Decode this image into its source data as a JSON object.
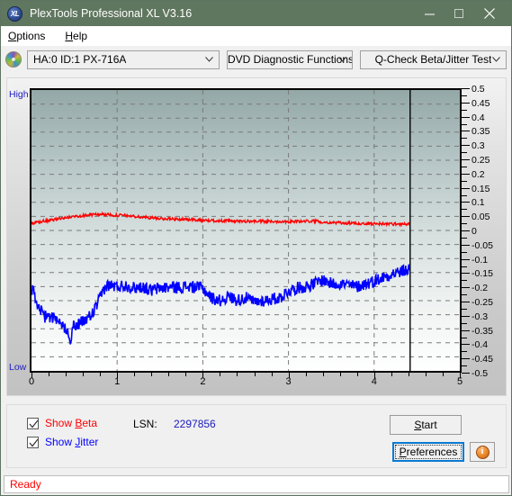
{
  "window": {
    "title": "PlexTools Professional XL V3.16",
    "icon": "XL",
    "minimize": "minimize-icon",
    "maximize": "maximize-icon",
    "close": "close-icon",
    "titlebar_color": "#60775f"
  },
  "menu": {
    "items": [
      {
        "label": "Options",
        "accel": "O"
      },
      {
        "label": "Help",
        "accel": "H"
      }
    ]
  },
  "toolbar": {
    "drive": "HA:0 ID:1  PX-716A",
    "function": "DVD Diagnostic Functions",
    "test": "Q-Check Beta/Jitter Test"
  },
  "chart_data": {
    "type": "line",
    "title": "Q-Check Beta/Jitter Test",
    "xlabel": "",
    "ylabel": "",
    "xlim": [
      0,
      5
    ],
    "ylim": [
      -0.5,
      0.5
    ],
    "grid": true,
    "legend": "none",
    "left_axis_high": "High",
    "left_axis_low": "Low",
    "xticks": [
      0,
      1,
      2,
      3,
      4,
      5
    ],
    "xtick_labels": [
      "0",
      "1",
      "2",
      "3",
      "4",
      "5"
    ],
    "yticks": [
      0.5,
      0.45,
      0.4,
      0.35,
      0.3,
      0.25,
      0.2,
      0.15,
      0.1,
      0.05,
      0,
      -0.05,
      -0.1,
      -0.15,
      -0.2,
      -0.25,
      -0.3,
      -0.35,
      -0.4,
      -0.45,
      -0.5
    ],
    "ytick_labels": [
      "0.5",
      "0.45",
      "0.4",
      "0.35",
      "0.3",
      "0.25",
      "0.2",
      "0.15",
      "0.1",
      "0.05",
      "0",
      "-0.05",
      "-0.1",
      "-0.15",
      "-0.2",
      "-0.25",
      "-0.3",
      "-0.35",
      "-0.4",
      "-0.45",
      "-0.5"
    ],
    "data_end_x": 4.42,
    "series": [
      {
        "name": "Beta",
        "color": "#ff0000",
        "x": [
          0.0,
          0.05,
          0.1,
          0.15,
          0.2,
          0.25,
          0.3,
          0.35,
          0.4,
          0.45,
          0.5,
          0.55,
          0.6,
          0.65,
          0.7,
          0.75,
          0.8,
          0.85,
          0.9,
          0.95,
          1.0,
          1.05,
          1.1,
          1.15,
          1.2,
          1.25,
          1.3,
          1.35,
          1.4,
          1.45,
          1.5,
          1.55,
          1.6,
          1.65,
          1.7,
          1.75,
          1.8,
          1.85,
          1.9,
          1.95,
          2.0,
          2.1,
          2.2,
          2.3,
          2.4,
          2.5,
          2.6,
          2.7,
          2.8,
          2.9,
          3.0,
          3.1,
          3.2,
          3.3,
          3.4,
          3.5,
          3.6,
          3.7,
          3.8,
          3.9,
          4.0,
          4.1,
          4.2,
          4.3,
          4.42
        ],
        "y": [
          0.022,
          0.027,
          0.03,
          0.034,
          0.033,
          0.038,
          0.041,
          0.043,
          0.045,
          0.047,
          0.05,
          0.052,
          0.053,
          0.055,
          0.056,
          0.057,
          0.058,
          0.057,
          0.056,
          0.055,
          0.054,
          0.054,
          0.053,
          0.052,
          0.05,
          0.048,
          0.047,
          0.046,
          0.045,
          0.044,
          0.043,
          0.042,
          0.042,
          0.041,
          0.04,
          0.04,
          0.039,
          0.038,
          0.038,
          0.037,
          0.036,
          0.035,
          0.034,
          0.034,
          0.033,
          0.033,
          0.033,
          0.032,
          0.032,
          0.032,
          0.032,
          0.032,
          0.033,
          0.034,
          0.03,
          0.028,
          0.027,
          0.026,
          0.025,
          0.024,
          0.024,
          0.024,
          0.023,
          0.023,
          0.023
        ]
      },
      {
        "name": "Jitter",
        "color": "#0000ff",
        "x": [
          0.0,
          0.03,
          0.06,
          0.09,
          0.12,
          0.15,
          0.18,
          0.21,
          0.24,
          0.27,
          0.3,
          0.33,
          0.36,
          0.39,
          0.42,
          0.45,
          0.48,
          0.51,
          0.54,
          0.57,
          0.6,
          0.63,
          0.66,
          0.69,
          0.72,
          0.75,
          0.78,
          0.81,
          0.84,
          0.87,
          0.9,
          0.95,
          1.0,
          1.1,
          1.2,
          1.3,
          1.4,
          1.5,
          1.6,
          1.7,
          1.8,
          1.9,
          2.0,
          2.1,
          2.2,
          2.3,
          2.4,
          2.5,
          2.6,
          2.7,
          2.8,
          2.9,
          3.0,
          3.1,
          3.2,
          3.3,
          3.4,
          3.5,
          3.6,
          3.7,
          3.8,
          3.9,
          4.0,
          4.1,
          4.2,
          4.3,
          4.42
        ],
        "y": [
          -0.205,
          -0.225,
          -0.27,
          -0.285,
          -0.28,
          -0.31,
          -0.3,
          -0.315,
          -0.305,
          -0.32,
          -0.33,
          -0.335,
          -0.34,
          -0.345,
          -0.35,
          -0.395,
          -0.345,
          -0.34,
          -0.335,
          -0.33,
          -0.325,
          -0.32,
          -0.31,
          -0.305,
          -0.29,
          -0.275,
          -0.255,
          -0.235,
          -0.21,
          -0.2,
          -0.195,
          -0.197,
          -0.2,
          -0.195,
          -0.205,
          -0.2,
          -0.215,
          -0.205,
          -0.202,
          -0.203,
          -0.2,
          -0.202,
          -0.205,
          -0.24,
          -0.25,
          -0.235,
          -0.248,
          -0.24,
          -0.255,
          -0.25,
          -0.245,
          -0.24,
          -0.215,
          -0.205,
          -0.2,
          -0.19,
          -0.175,
          -0.19,
          -0.188,
          -0.195,
          -0.2,
          -0.19,
          -0.18,
          -0.168,
          -0.155,
          -0.148,
          -0.138
        ]
      }
    ]
  },
  "controls": {
    "show_beta": {
      "label": "Show Beta",
      "accel": "B",
      "checked": true,
      "color": "#ff0000"
    },
    "show_jitter": {
      "label": "Show Jitter",
      "accel": "J",
      "checked": true,
      "color": "#0000ff"
    },
    "lsn_label": "LSN:",
    "lsn_value": "2297856",
    "start_button": {
      "label": "Start",
      "accel": "S"
    },
    "preferences_button": {
      "label": "Preferences",
      "accel": "P"
    },
    "info_button": "info-icon"
  },
  "statusbar": {
    "text": "Ready",
    "color": "#ff0000"
  }
}
